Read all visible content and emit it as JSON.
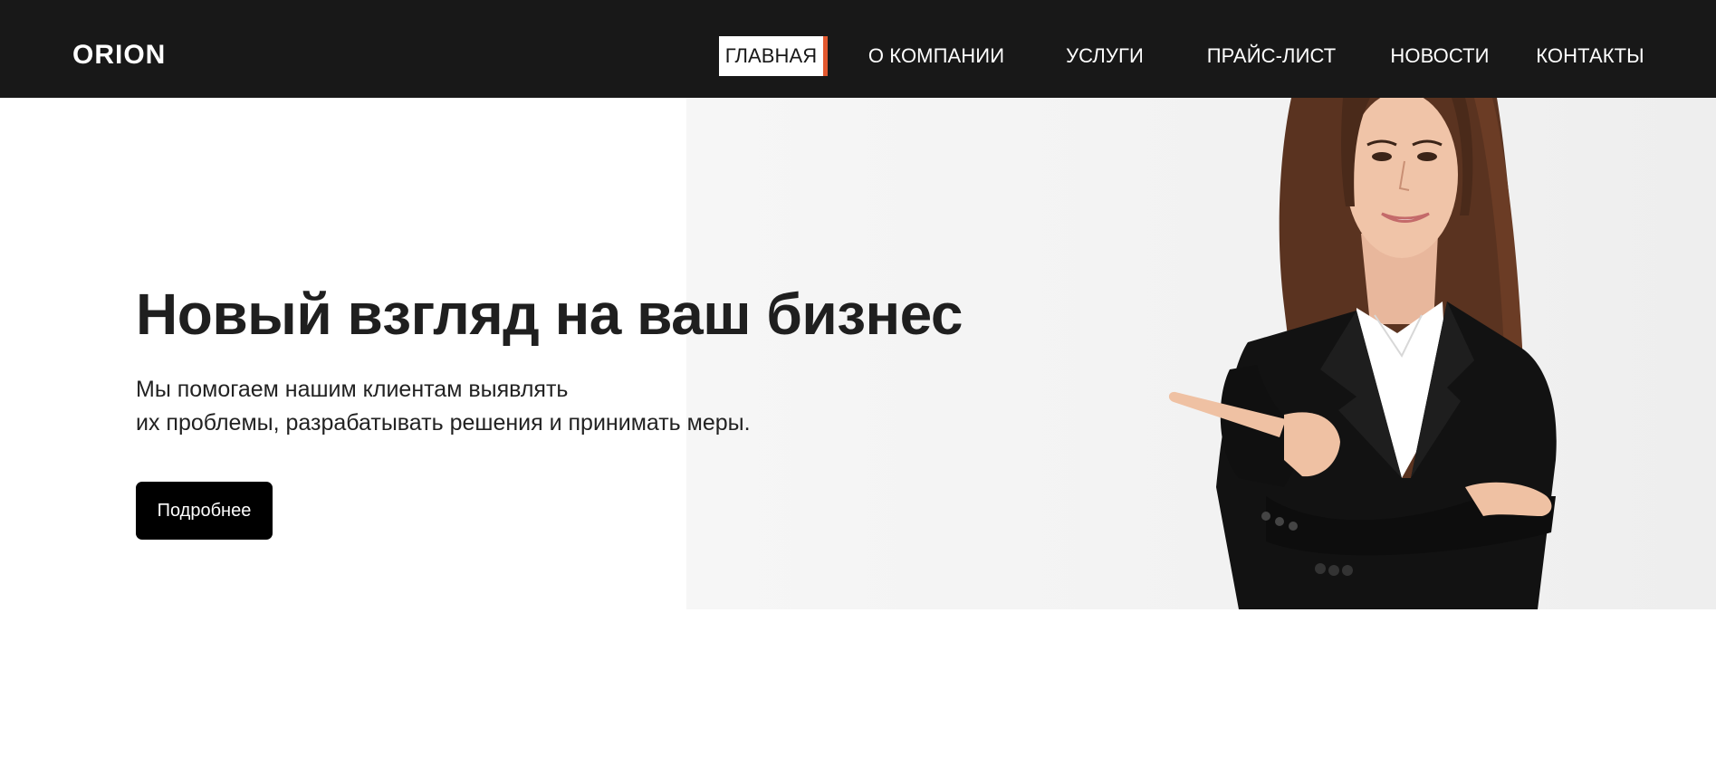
{
  "header": {
    "logo_text": "ORION",
    "nav": [
      {
        "label": "ГЛАВНАЯ",
        "active": true
      },
      {
        "label": "О КОМПАНИИ",
        "active": false
      },
      {
        "label": "УСЛУГИ",
        "active": false
      },
      {
        "label": "ПРАЙС-ЛИСТ",
        "active": false
      },
      {
        "label": "НОВОСТИ",
        "active": false
      },
      {
        "label": "КОНТАКТЫ",
        "active": false
      }
    ]
  },
  "hero": {
    "title": "Новый взгляд на ваш бизнес",
    "subtitle_line1": "Мы помогаем нашим клиентам выявлять",
    "subtitle_line2": "их проблемы, разрабатывать решения и принимать меры.",
    "button_label": "Подробнее",
    "image": "businesswoman-pointing-photo"
  },
  "colors": {
    "header_bg": "#181818",
    "accent": "#e2582f",
    "button_bg": "#000000",
    "text": "#1f1f1f"
  }
}
